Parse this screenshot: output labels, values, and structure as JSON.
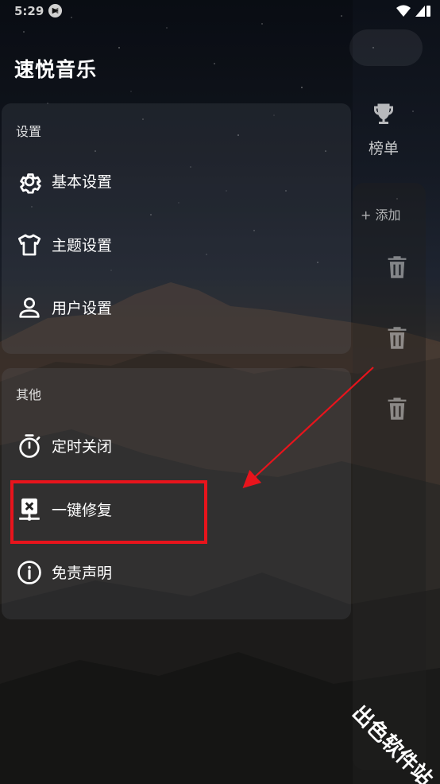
{
  "status_bar": {
    "time": "5:29"
  },
  "app": {
    "title": "速悦音乐"
  },
  "background_page": {
    "rank_label": "榜单",
    "add_label": "+ 添加"
  },
  "drawer": {
    "settings_section": {
      "label": "设置",
      "items": [
        {
          "label": "基本设置",
          "icon": "gear-icon"
        },
        {
          "label": "主题设置",
          "icon": "tshirt-icon"
        },
        {
          "label": "用户设置",
          "icon": "person-icon"
        }
      ]
    },
    "other_section": {
      "label": "其他",
      "items": [
        {
          "label": "定时关闭",
          "icon": "timer-icon"
        },
        {
          "label": "一键修复",
          "icon": "repair-icon"
        },
        {
          "label": "免责声明",
          "icon": "info-icon"
        }
      ]
    }
  },
  "watermark": {
    "text": "出色软件站"
  },
  "colors": {
    "highlight": "#e8141c",
    "arrow": "#e8141c"
  }
}
